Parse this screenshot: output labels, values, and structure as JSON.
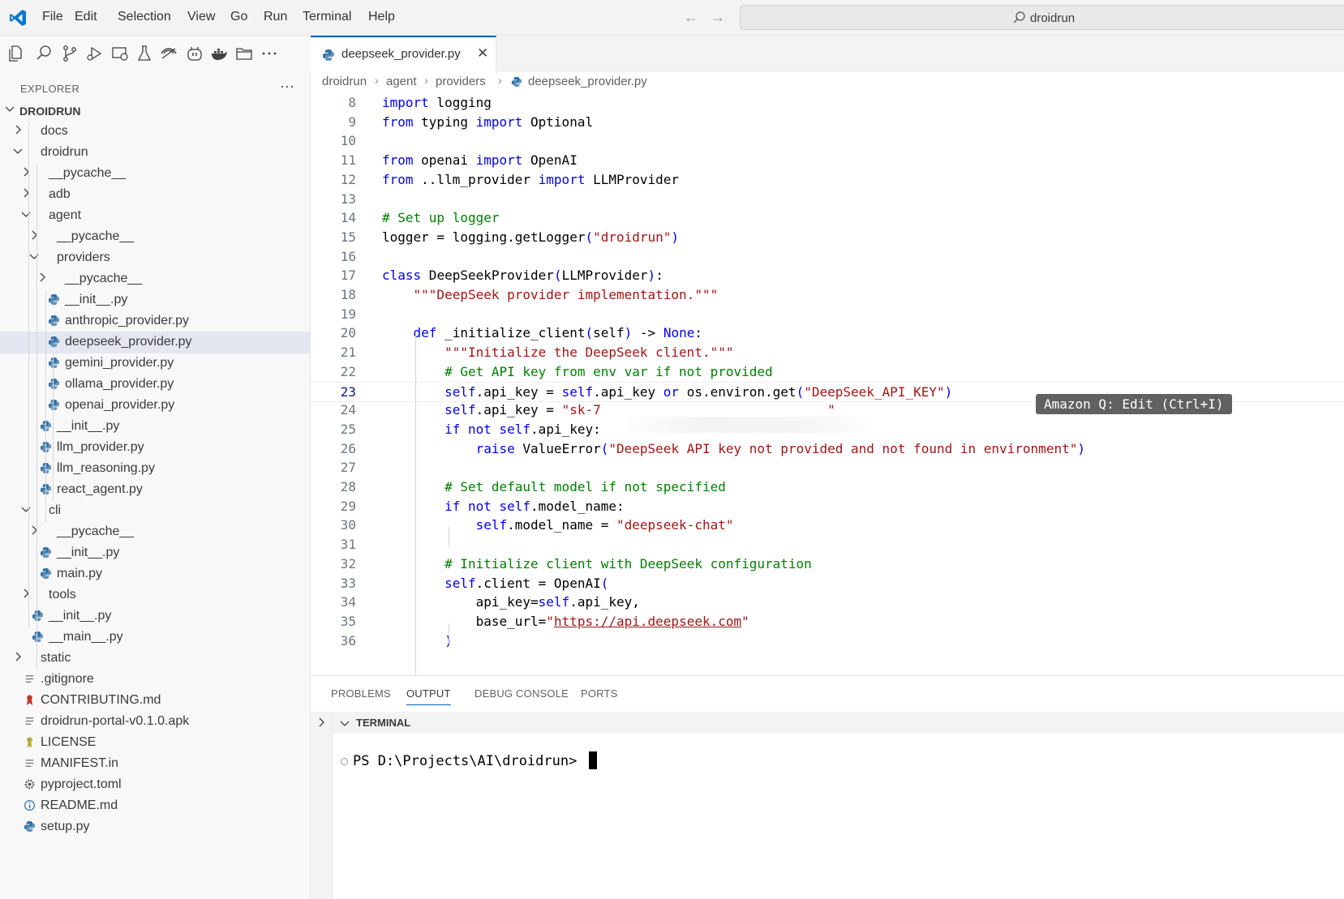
{
  "titlebar": {
    "menu": [
      "File",
      "Edit",
      "Selection",
      "View",
      "Go",
      "Run",
      "Terminal",
      "Help"
    ],
    "back_glyph": "←",
    "forward_glyph": "→",
    "search_label": "droidrun"
  },
  "activity_icons": [
    "explorer-icon",
    "search-icon",
    "source-control-icon",
    "run-debug-icon",
    "remote-explorer-icon",
    "testing-icon",
    "extension-icon",
    "copilot-icon",
    "docker-icon",
    "folder-icon",
    "more-icon"
  ],
  "sidebar": {
    "title": "EXPLORER",
    "more": "···",
    "tree": [
      {
        "label": "DROIDRUN",
        "kind": "root"
      },
      {
        "label": "docs",
        "kind": "folder"
      },
      {
        "label": "droidrun",
        "kind": "folder-open"
      },
      {
        "label": "__pycache__",
        "kind": "folder"
      },
      {
        "label": "adb",
        "kind": "folder"
      },
      {
        "label": "agent",
        "kind": "folder-open"
      },
      {
        "label": "__pycache__",
        "kind": "folder"
      },
      {
        "label": "providers",
        "kind": "folder-open"
      },
      {
        "label": "__pycache__",
        "kind": "folder"
      },
      {
        "label": "__init__.py",
        "kind": "python"
      },
      {
        "label": "anthropic_provider.py",
        "kind": "python"
      },
      {
        "label": "deepseek_provider.py",
        "kind": "python"
      },
      {
        "label": "gemini_provider.py",
        "kind": "python"
      },
      {
        "label": "ollama_provider.py",
        "kind": "python"
      },
      {
        "label": "openai_provider.py",
        "kind": "python"
      },
      {
        "label": "__init__.py",
        "kind": "python"
      },
      {
        "label": "llm_provider.py",
        "kind": "python"
      },
      {
        "label": "llm_reasoning.py",
        "kind": "python"
      },
      {
        "label": "react_agent.py",
        "kind": "python"
      },
      {
        "label": "cli",
        "kind": "folder-open"
      },
      {
        "label": "__pycache__",
        "kind": "folder"
      },
      {
        "label": "__init__.py",
        "kind": "python"
      },
      {
        "label": "main.py",
        "kind": "python"
      },
      {
        "label": "tools",
        "kind": "folder"
      },
      {
        "label": "__init__.py",
        "kind": "python"
      },
      {
        "label": "__main__.py",
        "kind": "python"
      },
      {
        "label": "static",
        "kind": "folder"
      },
      {
        "label": ".gitignore",
        "kind": "lines"
      },
      {
        "label": "CONTRIBUTING.md",
        "kind": "ribbon"
      },
      {
        "label": "droidrun-portal-v0.1.0.apk",
        "kind": "lines"
      },
      {
        "label": "LICENSE",
        "kind": "license"
      },
      {
        "label": "MANIFEST.in",
        "kind": "lines"
      },
      {
        "label": "pyproject.toml",
        "kind": "gear"
      },
      {
        "label": "README.md",
        "kind": "info"
      },
      {
        "label": "setup.py",
        "kind": "python"
      }
    ],
    "selected_label": "deepseek_provider.py"
  },
  "editor": {
    "tab_label": "deepseek_provider.py",
    "tab_close": "✕",
    "breadcrumb": [
      "droidrun",
      "agent",
      "providers",
      "deepseek_provider.py"
    ],
    "breadcrumb_sep": "›",
    "current_line": 23,
    "lines": [
      {
        "n": 8,
        "tokens": [
          [
            "kw",
            "import"
          ],
          [
            "",
            " logging"
          ]
        ]
      },
      {
        "n": 9,
        "tokens": [
          [
            "kw",
            "from"
          ],
          [
            "",
            " typing "
          ],
          [
            "kw",
            "import"
          ],
          [
            "",
            " Optional"
          ]
        ]
      },
      {
        "n": 10,
        "tokens": []
      },
      {
        "n": 11,
        "tokens": [
          [
            "kw",
            "from"
          ],
          [
            "",
            " openai "
          ],
          [
            "kw",
            "import"
          ],
          [
            "",
            " OpenAI"
          ]
        ]
      },
      {
        "n": 12,
        "tokens": [
          [
            "kw",
            "from"
          ],
          [
            "",
            " ..llm_provider "
          ],
          [
            "kw",
            "import"
          ],
          [
            "",
            " LLMProvider"
          ]
        ]
      },
      {
        "n": 13,
        "tokens": []
      },
      {
        "n": 14,
        "tokens": [
          [
            "com",
            "# Set up logger"
          ]
        ]
      },
      {
        "n": 15,
        "tokens": [
          [
            "",
            "logger = logging.getLogger"
          ],
          [
            "kw",
            "("
          ],
          [
            "str",
            "\"droidrun\""
          ],
          [
            "kw",
            ")"
          ]
        ]
      },
      {
        "n": 16,
        "tokens": []
      },
      {
        "n": 17,
        "tokens": [
          [
            "kw",
            "class"
          ],
          [
            "",
            " DeepSeekProvider"
          ],
          [
            "kw",
            "("
          ],
          [
            "",
            "LLMProvider"
          ],
          [
            "kw",
            ")"
          ],
          [
            "",
            ":"
          ]
        ]
      },
      {
        "n": 18,
        "tokens": [
          [
            "",
            "    "
          ],
          [
            "str",
            "\"\"\"DeepSeek provider implementation.\"\"\""
          ]
        ]
      },
      {
        "n": 19,
        "tokens": []
      },
      {
        "n": 20,
        "tokens": [
          [
            "",
            "    "
          ],
          [
            "kw",
            "def"
          ],
          [
            "",
            " _initialize_client"
          ],
          [
            "kw",
            "("
          ],
          [
            "",
            "self"
          ],
          [
            "kw",
            ")"
          ],
          [
            "",
            " -> "
          ],
          [
            "kw",
            "None"
          ],
          [
            "",
            ":"
          ]
        ]
      },
      {
        "n": 21,
        "tokens": [
          [
            "",
            "        "
          ],
          [
            "str",
            "\"\"\"Initialize the DeepSeek client.\"\"\""
          ]
        ]
      },
      {
        "n": 22,
        "tokens": [
          [
            "",
            "        "
          ],
          [
            "com",
            "# Get API key from env var if not provided"
          ]
        ]
      },
      {
        "n": 23,
        "tokens": [
          [
            "",
            "        "
          ],
          [
            "self",
            "self"
          ],
          [
            "",
            ".api_key = "
          ],
          [
            "self",
            "self"
          ],
          [
            "",
            ".api_key "
          ],
          [
            "kw",
            "or"
          ],
          [
            "",
            " os.environ.get"
          ],
          [
            "kw",
            "("
          ],
          [
            "str",
            "\"DeepSeek_API_KEY\""
          ],
          [
            "kw",
            ")"
          ]
        ]
      },
      {
        "n": 24,
        "tokens": [
          [
            "",
            "        "
          ],
          [
            "self",
            "self"
          ],
          [
            "",
            ".api_key = "
          ],
          [
            "str",
            "\"sk-7                             \""
          ]
        ]
      },
      {
        "n": 25,
        "tokens": [
          [
            "",
            "        "
          ],
          [
            "kw",
            "if"
          ],
          [
            "",
            " "
          ],
          [
            "kw",
            "not"
          ],
          [
            "",
            " "
          ],
          [
            "self",
            "self"
          ],
          [
            "",
            ".api_key:"
          ]
        ]
      },
      {
        "n": 26,
        "tokens": [
          [
            "",
            "            "
          ],
          [
            "kw",
            "raise"
          ],
          [
            "",
            " ValueError"
          ],
          [
            "kw",
            "("
          ],
          [
            "str",
            "\"DeepSeek API key not provided and not found in environment\""
          ],
          [
            "kw",
            ")"
          ]
        ]
      },
      {
        "n": 27,
        "tokens": []
      },
      {
        "n": 28,
        "tokens": [
          [
            "",
            "        "
          ],
          [
            "com",
            "# Set default model if not specified"
          ]
        ]
      },
      {
        "n": 29,
        "tokens": [
          [
            "",
            "        "
          ],
          [
            "kw",
            "if"
          ],
          [
            "",
            " "
          ],
          [
            "kw",
            "not"
          ],
          [
            "",
            " "
          ],
          [
            "self",
            "self"
          ],
          [
            "",
            ".model_name:"
          ]
        ]
      },
      {
        "n": 30,
        "tokens": [
          [
            "",
            "            "
          ],
          [
            "self",
            "self"
          ],
          [
            "",
            ".model_name = "
          ],
          [
            "str",
            "\"deepseek-chat\""
          ]
        ]
      },
      {
        "n": 31,
        "tokens": []
      },
      {
        "n": 32,
        "tokens": [
          [
            "",
            "        "
          ],
          [
            "com",
            "# Initialize client with DeepSeek configuration"
          ]
        ]
      },
      {
        "n": 33,
        "tokens": [
          [
            "",
            "        "
          ],
          [
            "self",
            "self"
          ],
          [
            "",
            ".client = OpenAI"
          ],
          [
            "kw",
            "("
          ]
        ]
      },
      {
        "n": 34,
        "tokens": [
          [
            "",
            "            api_key="
          ],
          [
            "self",
            "self"
          ],
          [
            "",
            ".api_key,"
          ]
        ]
      },
      {
        "n": 35,
        "tokens": [
          [
            "",
            "            base_url="
          ],
          [
            "str",
            "\""
          ],
          [
            "url",
            "https://api.deepseek.com"
          ],
          [
            "str",
            "\""
          ]
        ]
      },
      {
        "n": 36,
        "tokens": [
          [
            "",
            "        "
          ],
          [
            "kw",
            ")"
          ]
        ]
      }
    ],
    "inline_hint": "Amazon Q: Edit (Ctrl+I)"
  },
  "panel": {
    "tabs": [
      "PROBLEMS",
      "OUTPUT",
      "DEBUG CONSOLE",
      "PORTS"
    ],
    "active_tab": "OUTPUT",
    "terminal_title": "TERMINAL",
    "prompt": "PS D:\\Projects\\AI\\droidrun> "
  },
  "colors": {
    "accent": "#005fb8",
    "keyword": "#0000ff",
    "string": "#a31515",
    "comment": "#008000",
    "selected_row": "#e4e6f1"
  }
}
